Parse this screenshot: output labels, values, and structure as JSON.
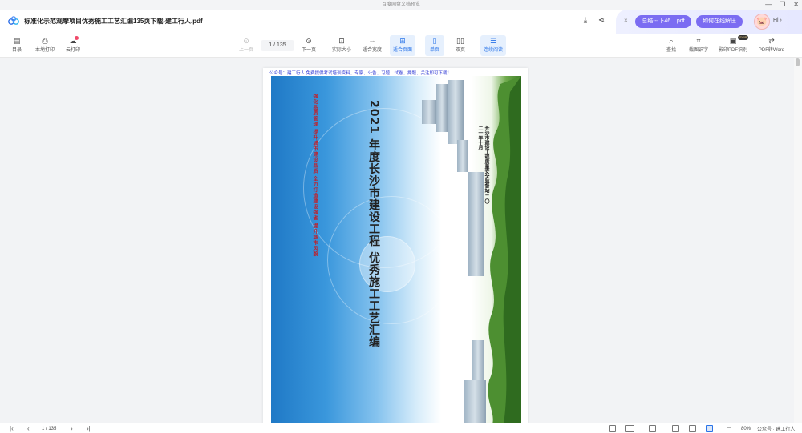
{
  "window": {
    "title": "百度网盘文档预览",
    "controls": [
      "—",
      "❐",
      "✕"
    ]
  },
  "header": {
    "doc_title": "标准化示范观摩项目优秀施工工艺汇编135页下载-建工行人.pdf",
    "download_icon": "download-icon",
    "share_icon": "share-icon"
  },
  "promo": {
    "close": "×",
    "file_pill": "总结---下46....pdf",
    "help_pill": "如何在线解压",
    "avatar": "🐷",
    "greeting": "Hi ›"
  },
  "toolbar": {
    "left": [
      {
        "label": "目录",
        "icon": "toc-icon",
        "glyph": "▤"
      },
      {
        "label": "本地打印",
        "icon": "print-icon",
        "glyph": "⎙"
      },
      {
        "label": "云打印",
        "icon": "cloud-print-icon",
        "glyph": "☁"
      }
    ],
    "prev": {
      "label": "上一页",
      "glyph": "⊙"
    },
    "page_indicator": "1  / 135",
    "next": {
      "label": "下一页",
      "glyph": "⊙"
    },
    "actual_size": {
      "label": "实际大小",
      "glyph": "⊡"
    },
    "fit_width": {
      "label": "适合宽度",
      "glyph": "⇔"
    },
    "fit_page": {
      "label": "适合页面",
      "glyph": "⊞"
    },
    "single": {
      "label": "单页",
      "glyph": "▯"
    },
    "double": {
      "label": "双页",
      "glyph": "▯▯"
    },
    "continuous": {
      "label": "连续阅读",
      "glyph": "☰"
    },
    "right": [
      {
        "label": "查找",
        "icon": "search-icon",
        "glyph": "⌕"
      },
      {
        "label": "截图识字",
        "icon": "screenshot-ocr-icon",
        "glyph": "⌗"
      },
      {
        "label": "影印PDF识别",
        "icon": "pdf-ocr-icon",
        "glyph": "▣",
        "badge": "SVIP"
      },
      {
        "label": "PDF转Word",
        "icon": "pdf-to-word-icon",
        "glyph": "⇄"
      }
    ]
  },
  "document": {
    "notice": "公众号：建工行人 免费提供考试培训资料、专家、公告、习题、试卷、押题、关注即可下载！",
    "cover_title_line1": "2021 年度长沙市建设工程",
    "cover_title_line2": "优秀施工工艺汇编",
    "cover_slogan": "强化品质管理 提升城市建设品质  全力打造建设强省 提升城市风貌",
    "cover_org_line1": "长沙市建设工程质量安全监督站",
    "cover_org_line2": "二〇二一年十月"
  },
  "bottom": {
    "first": "|‹",
    "prev": "‹",
    "page": "1  / 135",
    "next": "›",
    "last": "›|",
    "zoom_minus": "—",
    "zoom_value": "80%",
    "watermark": "公众号 · 建工行人"
  },
  "colors": {
    "accent": "#2a74e8",
    "promo_pill": "#7b6cf2",
    "notice_text": "#2b35d4"
  }
}
